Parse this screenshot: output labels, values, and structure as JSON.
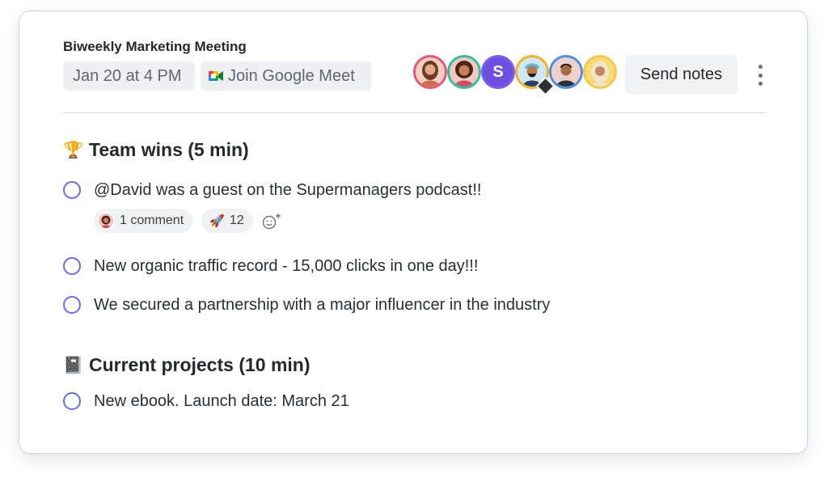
{
  "meeting": {
    "title": "Biweekly Marketing Meeting",
    "date": "Jan 20 at 4 PM",
    "meet_label": "Join Google Meet"
  },
  "attendees": [
    {
      "name": "attendee-1",
      "ring": "#e9567b"
    },
    {
      "name": "attendee-2",
      "ring": "#2fbfa0"
    },
    {
      "name": "attendee-s",
      "ring": "#7b5cf0",
      "initial": "S"
    },
    {
      "name": "attendee-4",
      "ring": "#f2b31c"
    },
    {
      "name": "attendee-5",
      "ring": "#4a8fe6"
    },
    {
      "name": "attendee-6",
      "ring": "#f2c94c"
    }
  ],
  "actions": {
    "send_notes": "Send notes",
    "more_icon": "vertical-ellipsis-icon"
  },
  "sections": [
    {
      "emoji": "🏆",
      "heading": "Team wins (5 min)",
      "items": [
        {
          "text": "@David was a guest on the Supermanagers podcast!!"
        },
        {
          "text": "New organic traffic record - 15,000 clicks in one day!!!"
        },
        {
          "text": "We secured a partnership with a major influencer in the industry"
        }
      ]
    },
    {
      "emoji": "📓",
      "heading": "Current projects (10 min)",
      "items": [
        {
          "text": "New ebook. Launch date: March 21"
        }
      ]
    }
  ],
  "reactions": {
    "comment_label": "1 comment",
    "rocket_emoji": "🚀",
    "rocket_count": "12",
    "add_reaction_icon": "add-emoji-icon"
  }
}
